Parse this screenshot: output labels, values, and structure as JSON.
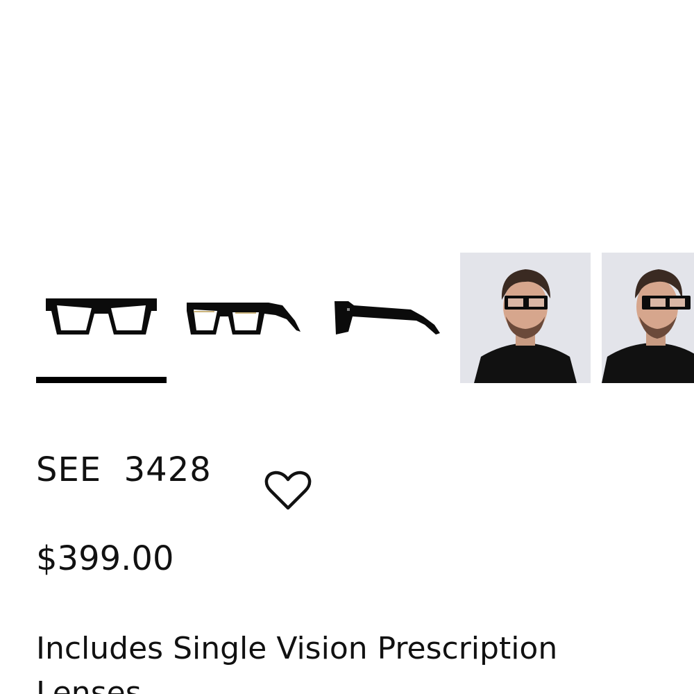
{
  "gallery": {
    "thumbnails": [
      {
        "icon": "glasses-front-icon",
        "active": true
      },
      {
        "icon": "glasses-angle-icon",
        "active": false
      },
      {
        "icon": "glasses-side-icon",
        "active": false
      },
      {
        "icon": "model-front-photo",
        "active": false
      },
      {
        "icon": "model-angle-photo",
        "active": false
      }
    ]
  },
  "product": {
    "name": "SEE  3428",
    "price": "$399.00",
    "wishlist_icon": "heart-icon",
    "prescription_note": "Includes Single Vision Prescription Lenses"
  },
  "colors": {
    "text": "#111111",
    "active_indicator": "#000000",
    "photo_background": "#e3e4ea"
  }
}
